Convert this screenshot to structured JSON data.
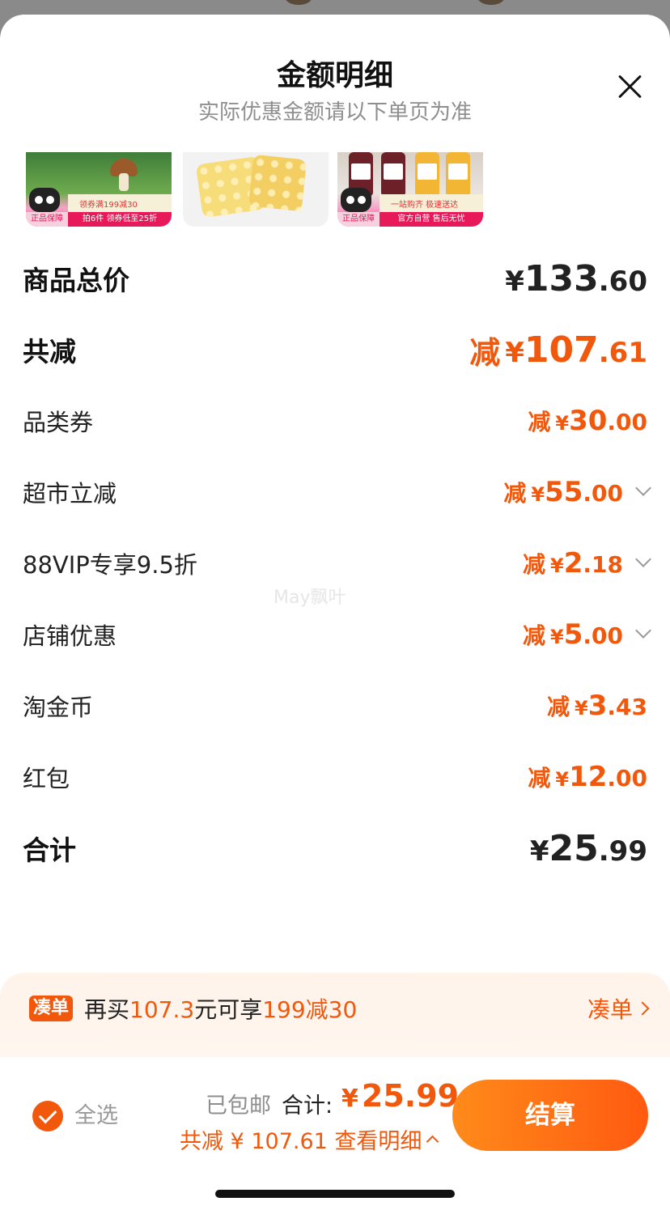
{
  "header": {
    "title": "金额明细",
    "subtitle": "实际优惠金额请以下单页为准"
  },
  "products": [
    {
      "promo_line1": "领券满199减30",
      "promo_line2": "拍6件 领券低至25折",
      "badge": "正品保障"
    },
    {
      "promo_line1": "",
      "promo_line2": "",
      "badge": ""
    },
    {
      "promo_line1": "一站购齐 极速送达",
      "promo_line2": "官方自营 售后无忧",
      "badge": "正品保障"
    }
  ],
  "breakdown": {
    "subtotal": {
      "label": "商品总价",
      "yen": "¥",
      "int": "133",
      "dec": ".60"
    },
    "total_reduction": {
      "label": "共减",
      "prefix": "减",
      "yen": "¥",
      "int": "107",
      "dec": ".61"
    },
    "items": [
      {
        "label": "品类券",
        "prefix": "减",
        "yen": "¥",
        "int": "30",
        "dec": ".00",
        "expandable": false
      },
      {
        "label": "超市立减",
        "prefix": "减",
        "yen": "¥",
        "int": "55",
        "dec": ".00",
        "expandable": true
      },
      {
        "label": "88VIP专享9.5折",
        "prefix": "减",
        "yen": "¥",
        "int": "2",
        "dec": ".18",
        "expandable": true
      },
      {
        "label": "店铺优惠",
        "prefix": "减",
        "yen": "¥",
        "int": "5",
        "dec": ".00",
        "expandable": true
      },
      {
        "label": "淘金币",
        "prefix": "减",
        "yen": "¥",
        "int": "3",
        "dec": ".43",
        "expandable": false
      },
      {
        "label": "红包",
        "prefix": "减",
        "yen": "¥",
        "int": "12",
        "dec": ".00",
        "expandable": false
      }
    ],
    "total": {
      "label": "合计",
      "yen": "¥",
      "int": "25",
      "dec": ".99"
    }
  },
  "watermark": "May飘叶",
  "coudan": {
    "tag": "凑单",
    "text_a": "再买",
    "amount": "107.3",
    "text_b": "元可享",
    "offer": "199减30",
    "link": "凑单"
  },
  "footer": {
    "select_all": "全选",
    "shipping": "已包邮",
    "total_label": "合计:",
    "total_yen": "¥",
    "total_value": "25.99",
    "reduction_text": "共减 ¥ 107.61",
    "details_link": "查看明细",
    "checkout": "结算"
  },
  "colors": {
    "accent": "#f2580c",
    "text": "#222222",
    "muted": "#8e8e8e"
  }
}
